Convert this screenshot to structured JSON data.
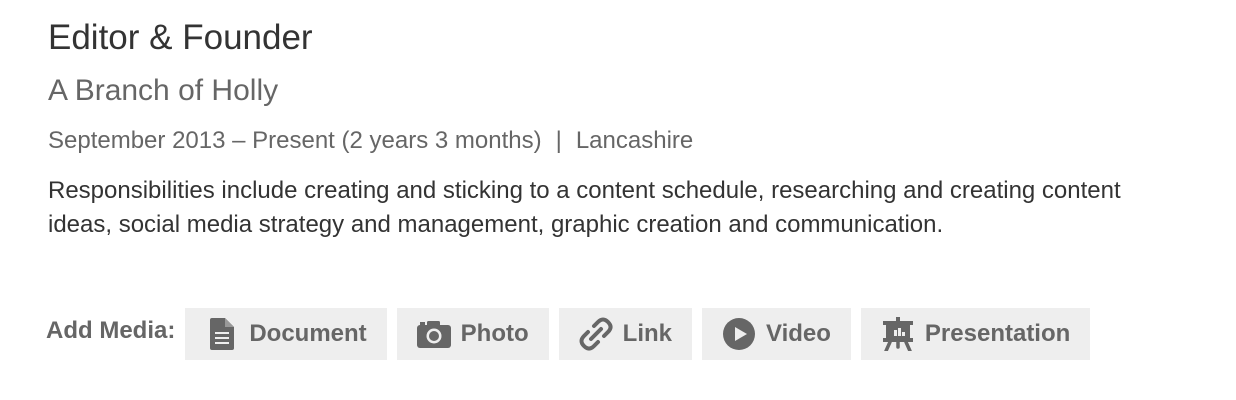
{
  "position": {
    "title": "Editor & Founder",
    "company": "A Branch of Holly",
    "dates": "September 2013 – Present (2 years 3 months)",
    "separator": "|",
    "location": "Lancashire",
    "description": "Responsibilities include creating and sticking to a content schedule, researching and creating content ideas, social media strategy and management, graphic creation and communication."
  },
  "media": {
    "label": "Add Media:",
    "buttons": [
      {
        "label": "Document",
        "icon": "document-icon"
      },
      {
        "label": "Photo",
        "icon": "camera-icon"
      },
      {
        "label": "Link",
        "icon": "link-icon"
      },
      {
        "label": "Video",
        "icon": "play-icon"
      },
      {
        "label": "Presentation",
        "icon": "presentation-icon"
      }
    ]
  },
  "colors": {
    "heading": "#333333",
    "secondary": "#666666",
    "button_bg": "#eeeeee"
  }
}
